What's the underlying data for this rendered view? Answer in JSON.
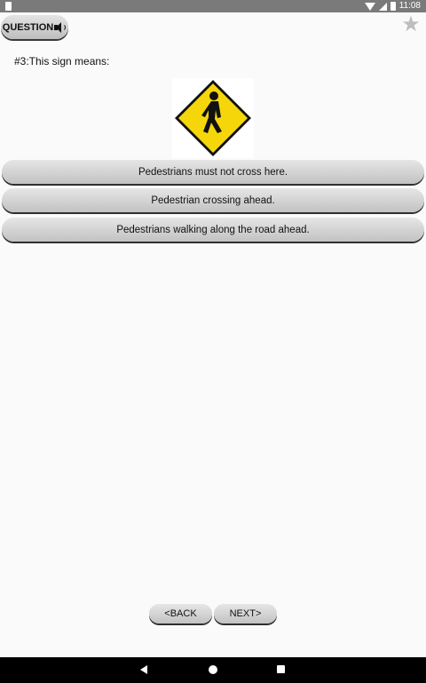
{
  "status_bar": {
    "time": "11:08"
  },
  "header": {
    "question_label": "QUESTION"
  },
  "question": {
    "prompt": "#3:This sign means:"
  },
  "sign": {
    "icon": "pedestrian-crossing-sign",
    "color": "#f5d60a"
  },
  "answers": [
    {
      "label": "Pedestrians must not cross here."
    },
    {
      "label": "Pedestrian crossing ahead."
    },
    {
      "label": "Pedestrians walking along the road ahead."
    }
  ],
  "navigation": {
    "back_label": "<BACK",
    "next_label": "NEXT>"
  }
}
